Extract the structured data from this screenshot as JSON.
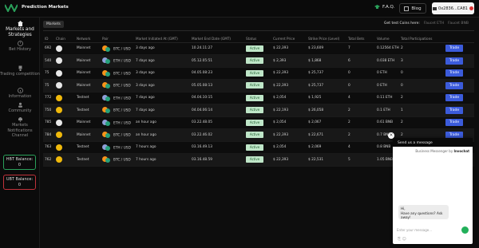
{
  "header": {
    "brand": "Prediction Markets",
    "faq_label": "F.A.Q.",
    "blog_label": "Blog",
    "wallet_address": "0x2836...CA81"
  },
  "sidebar": {
    "items": [
      {
        "label": "Markets and Strategies"
      },
      {
        "label": "Bet History"
      },
      {
        "label": "Trading competition"
      },
      {
        "label": "Information"
      },
      {
        "label": "Community"
      },
      {
        "label": "Markets Notifications Channel"
      }
    ],
    "hbt_balance_label": "HBT Balance:",
    "hbt_balance_value": "0",
    "ubt_balance_label": "UBT Balance:",
    "ubt_balance_value": "0"
  },
  "tabs": [
    {
      "label": "Markets"
    }
  ],
  "test_links": {
    "get_coins": "Get test Coins here:",
    "faucet_eth": "Faucet ETH",
    "faucet_bnb": "Faucet BNB"
  },
  "table": {
    "headers": [
      "ID",
      "Chain",
      "Network",
      "Pair",
      "Market Initiated At (GMT)",
      "Market End Date (GMT)",
      "Status",
      "Current Price",
      "Strike Price (Level)",
      "Total Bets",
      "Volume",
      "Total Participations",
      ""
    ],
    "rows": [
      {
        "id": "692",
        "network": "Mainnet",
        "pair": "BTC / USD",
        "initiated": "3 days ago",
        "end": "10.24.11:27",
        "status": "Active",
        "current": "$ 22,393",
        "strike": "$ 23,609",
        "bets": "7",
        "volume": "0.12564 ETH",
        "participations": "2",
        "trade": "Trade",
        "pair_type": "btc"
      },
      {
        "id": "540",
        "network": "Mainnet",
        "pair": "ETH / USD",
        "initiated": "7 days ago",
        "end": "05.12.05:51",
        "status": "Active",
        "current": "$ 2,393",
        "strike": "$ 1,868",
        "bets": "6",
        "volume": "0.038 ETH",
        "participations": "3",
        "trade": "Trade",
        "pair_type": "eth"
      },
      {
        "id": "75",
        "network": "Mainnet",
        "pair": "BTC / USD",
        "initiated": "3 days ago",
        "end": "04.05.08:23",
        "status": "Active",
        "current": "$ 22,393",
        "strike": "$ 25,737",
        "bets": "0",
        "volume": "0 ETH",
        "participations": "0",
        "trade": "Trade",
        "pair_type": "btc"
      },
      {
        "id": "75",
        "network": "Mainnet",
        "pair": "BTC / USD",
        "initiated": "3 days ago",
        "end": "05.05.08:13",
        "status": "Active",
        "current": "$ 22,393",
        "strike": "$ 25,737",
        "bets": "0",
        "volume": "0 ETH",
        "participations": "0",
        "trade": "Trade",
        "pair_type": "btc"
      },
      {
        "id": "772",
        "network": "Testnet",
        "pair": "ETH / USD",
        "initiated": "7 days ago",
        "end": "04.04.10:15",
        "status": "Active",
        "current": "$ 2,054",
        "strike": "$ 1,925",
        "bets": "4",
        "volume": "0.11 ETH",
        "participations": "2",
        "trade": "Trade",
        "pair_type": "eth"
      },
      {
        "id": "750",
        "network": "Testnet",
        "pair": "BTC / USD",
        "initiated": "7 days ago",
        "end": "04.04.06:14",
        "status": "Active",
        "current": "$ 22,193",
        "strike": "$ 26,058",
        "bets": "2",
        "volume": "0.1 ETH",
        "participations": "1",
        "trade": "Trade",
        "pair_type": "btc"
      },
      {
        "id": "785",
        "network": "Mainnet",
        "pair": "ETH / USD",
        "initiated": "an hour ago",
        "end": "03.22.48.05",
        "status": "Active",
        "current": "$ 2,054",
        "strike": "$ 2,067",
        "bets": "2",
        "volume": "0.61 BNB",
        "participations": "2",
        "trade": "Trade",
        "pair_type": "eth"
      },
      {
        "id": "784",
        "network": "Mainnet",
        "pair": "BTC / USD",
        "initiated": "an hour ago",
        "end": "03.22.46.02",
        "status": "Active",
        "current": "$ 22,393",
        "strike": "$ 22,671",
        "bets": "2",
        "volume": "0.7 BNB",
        "participations": "2",
        "trade": "Trade",
        "pair_type": "btc"
      },
      {
        "id": "763",
        "network": "Testnet",
        "pair": "ETH / USD",
        "initiated": "7 hours ago",
        "end": "03.16.49.13",
        "status": "Active",
        "current": "$ 2,054",
        "strike": "$ 2,069",
        "bets": "4",
        "volume": "0.8 BNB",
        "participations": "2",
        "trade": "Trade",
        "pair_type": "eth"
      },
      {
        "id": "762",
        "network": "Testnet",
        "pair": "BTC / USD",
        "initiated": "7 hours ago",
        "end": "03.16.48.59",
        "status": "Active",
        "current": "$ 22,393",
        "strike": "$ 22,531",
        "bets": "5",
        "volume": "1.05 BNB",
        "participations": "4",
        "trade": "Trade",
        "pair_type": "btc"
      }
    ]
  },
  "chat": {
    "title": "Send us a message",
    "subtitle_prefix": "Business Messenger by",
    "subtitle_brand": "Invochat",
    "greeting_line1": "Hi,",
    "greeting_line2": "Have any questions? Ask away!",
    "input_placeholder": "Enter your message..."
  },
  "colors": {
    "accent_green": "#2aa05a",
    "accent_red": "#c0323a",
    "trade_blue": "#3b5bdb"
  }
}
